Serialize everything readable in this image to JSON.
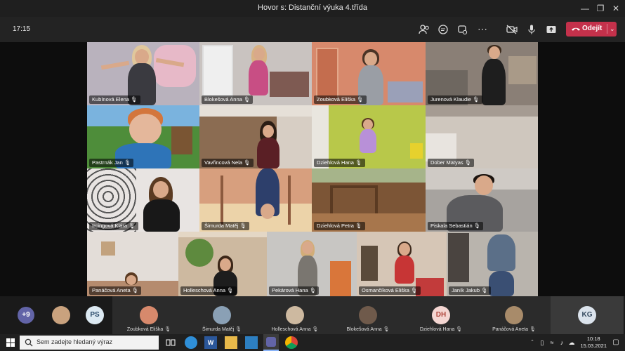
{
  "window": {
    "title": "Hovor s: Distanční výuka 4.třída"
  },
  "toolbar": {
    "time": "17:15",
    "leave_label": "Odejít"
  },
  "tiles": [
    {
      "name": "Kubínová Elena",
      "bg": "#b9b2bd"
    },
    {
      "name": "Blokešová Anna",
      "bg": "#c9c3c0"
    },
    {
      "name": "Zoubková Eliška",
      "bg": "#d7896c"
    },
    {
      "name": "Jurenová Klaudie",
      "bg": "#8a7f76"
    },
    {
      "name": "Pastrnák Jan",
      "bg": "#4e8d3a"
    },
    {
      "name": "Vavřincová Nela",
      "bg": "#8b6c52"
    },
    {
      "name": "Dziehlová Hana",
      "bg": "#b8c84a"
    },
    {
      "name": "Dober Matyas",
      "bg": "#cfc7be"
    },
    {
      "name": "Ircingová Klára",
      "bg": "#e8e4e2"
    },
    {
      "name": "Šimurda Matěj",
      "bg": "#d79f7e"
    },
    {
      "name": "Dziehlová Petra",
      "bg": "#7c5536"
    },
    {
      "name": "Piskala Sebastián",
      "bg": "#a7a39f"
    },
    {
      "name": "Panáčová Aneta",
      "bg": "#e3ddd8"
    },
    {
      "name": "Holleschová Anna",
      "bg": "#cdb9a0"
    },
    {
      "name": "Pekárová Hana",
      "bg": "#c8c6c3"
    },
    {
      "name": "Osmančíková Eliška",
      "bg": "#d6c6b6"
    },
    {
      "name": "Janík Jakub",
      "bg": "#b9b4ad"
    }
  ],
  "strip": {
    "overflow_count": "+9",
    "ps_initials": "PS",
    "kg_initials": "KG",
    "participants": [
      {
        "name": "Zoubková Eliška"
      },
      {
        "name": "Šimurda Matěj"
      },
      {
        "name": "Holleschová Anna"
      },
      {
        "name": "Blokešová Anna"
      },
      {
        "name": "Dziehlová Hana",
        "initials": "DH"
      },
      {
        "name": "Panáčová Aneta"
      }
    ]
  },
  "taskbar": {
    "search_placeholder": "Sem zadejte hledaný výraz",
    "time": "10:18",
    "date": "15.03.2021"
  },
  "colors": {
    "accent_leave": "#c4314b",
    "app_bg": "#0b0b0b",
    "mic_icon": "#ffffff"
  }
}
